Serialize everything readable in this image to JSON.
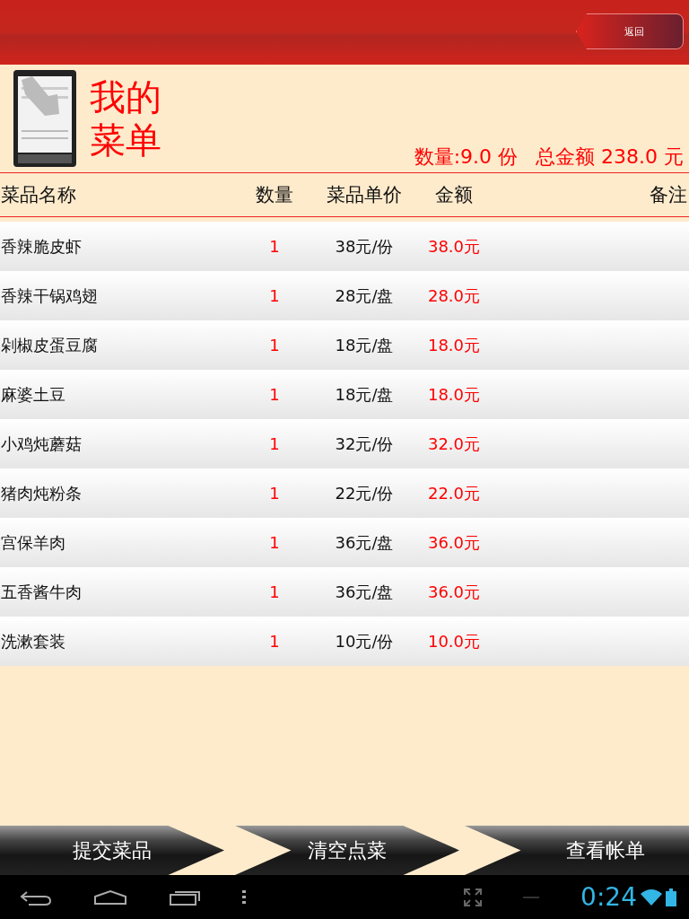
{
  "top_bar": {
    "back_button": "返回"
  },
  "title": {
    "line_1": "我的",
    "line_2": "菜单"
  },
  "summary": {
    "quantity": "数量:9.0 份",
    "total": "总金额 238.0 元"
  },
  "table": {
    "columns": [
      "菜品名称",
      "数量",
      "菜品单价",
      "金额",
      "备注"
    ],
    "rows": [
      {
        "name": "香辣脆皮虾",
        "qty": "1",
        "price": "38元/份",
        "amount": "38.0元"
      },
      {
        "name": "香辣干锅鸡翅",
        "qty": "1",
        "price": "28元/盘",
        "amount": "28.0元"
      },
      {
        "name": "剁椒皮蛋豆腐",
        "qty": "1",
        "price": "18元/盘",
        "amount": "18.0元"
      },
      {
        "name": "麻婆土豆",
        "qty": "1",
        "price": "18元/盘",
        "amount": "18.0元"
      },
      {
        "name": "小鸡炖蘑菇",
        "qty": "1",
        "price": "32元/份",
        "amount": "32.0元"
      },
      {
        "name": "猪肉炖粉条",
        "qty": "1",
        "price": "22元/份",
        "amount": "22.0元"
      },
      {
        "name": "宫保羊肉",
        "qty": "1",
        "price": "36元/盘",
        "amount": "36.0元"
      },
      {
        "name": "五香酱牛肉",
        "qty": "1",
        "price": "36元/盘",
        "amount": "36.0元"
      },
      {
        "name": "洗漱套装",
        "qty": "1",
        "price": "10元/份",
        "amount": "10.0元"
      }
    ]
  },
  "actions": [
    "提交菜品",
    "清空点菜",
    "查看帐单"
  ],
  "status_bar": {
    "time": "0:24"
  }
}
